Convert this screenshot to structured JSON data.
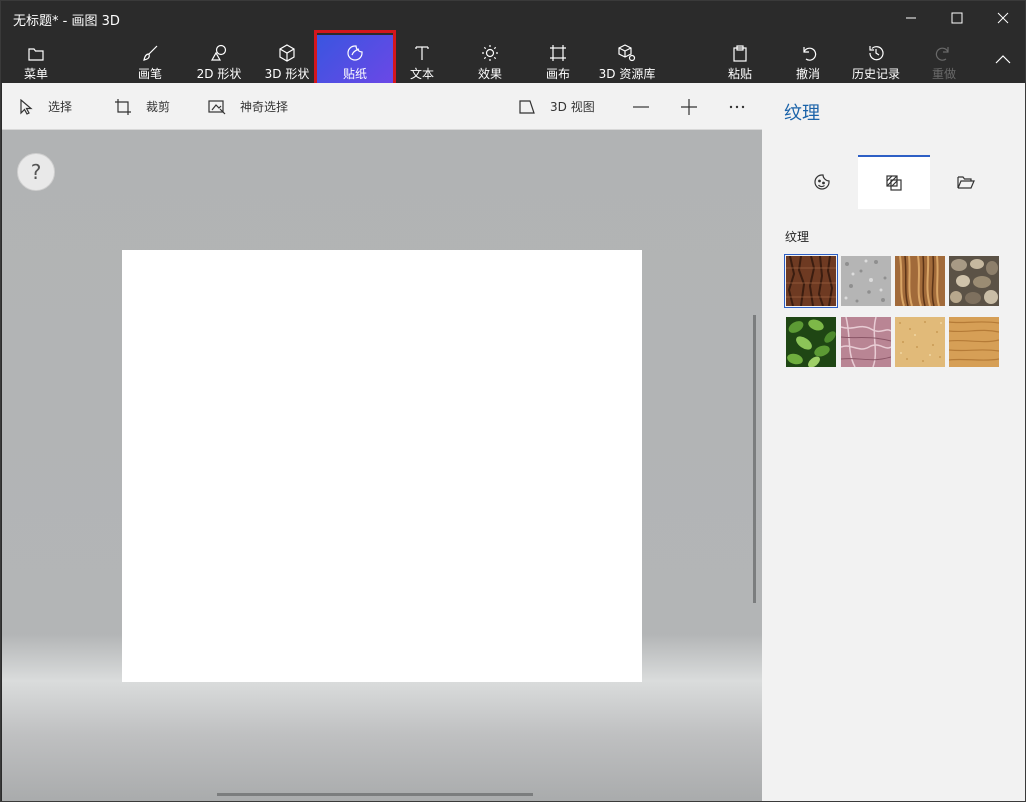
{
  "window": {
    "title": "无标题* - 画图 3D"
  },
  "ribbon": {
    "items": [
      {
        "label": "菜单",
        "icon": "folder-icon"
      },
      {
        "label": "画笔",
        "icon": "brush-icon"
      },
      {
        "label": "2D 形状",
        "icon": "2d-shapes-icon"
      },
      {
        "label": "3D 形状",
        "icon": "3d-cube-icon"
      },
      {
        "label": "贴纸",
        "icon": "sticker-icon",
        "active": true
      },
      {
        "label": "文本",
        "icon": "text-icon"
      },
      {
        "label": "效果",
        "icon": "sun-icon"
      },
      {
        "label": "画布",
        "icon": "canvas-icon"
      },
      {
        "label": "3D 资源库",
        "icon": "3d-library-icon"
      },
      {
        "label": "粘贴",
        "icon": "paste-icon"
      },
      {
        "label": "撤消",
        "icon": "undo-icon"
      },
      {
        "label": "历史记录",
        "icon": "history-icon"
      },
      {
        "label": "重做",
        "icon": "redo-icon",
        "disabled": true
      }
    ]
  },
  "toolbar": {
    "select_label": "选择",
    "crop_label": "裁剪",
    "magic_select_label": "神奇选择",
    "view3d_label": "3D 视图"
  },
  "canvas": {
    "help_label": "?"
  },
  "panel": {
    "title": "纹理",
    "tabs": [
      "sticker-face-icon",
      "texture-icon",
      "folder-open-icon"
    ],
    "active_tab": 1,
    "section_label": "纹理",
    "textures": [
      {
        "name": "bark",
        "color": "#6e3a22",
        "selected": true
      },
      {
        "name": "granite",
        "color": "#b5b5b5"
      },
      {
        "name": "hair",
        "color": "#a16a3a"
      },
      {
        "name": "pebbles",
        "color": "#7d6f5e"
      },
      {
        "name": "leaves",
        "color": "#3e7a28"
      },
      {
        "name": "marble",
        "color": "#b98594"
      },
      {
        "name": "sand",
        "color": "#e1ba79"
      },
      {
        "name": "wood",
        "color": "#d69f56"
      }
    ]
  },
  "colors": {
    "accent": "#2d5fc5",
    "title_blue": "#1b63a9",
    "highlight_red": "#d4161c"
  }
}
